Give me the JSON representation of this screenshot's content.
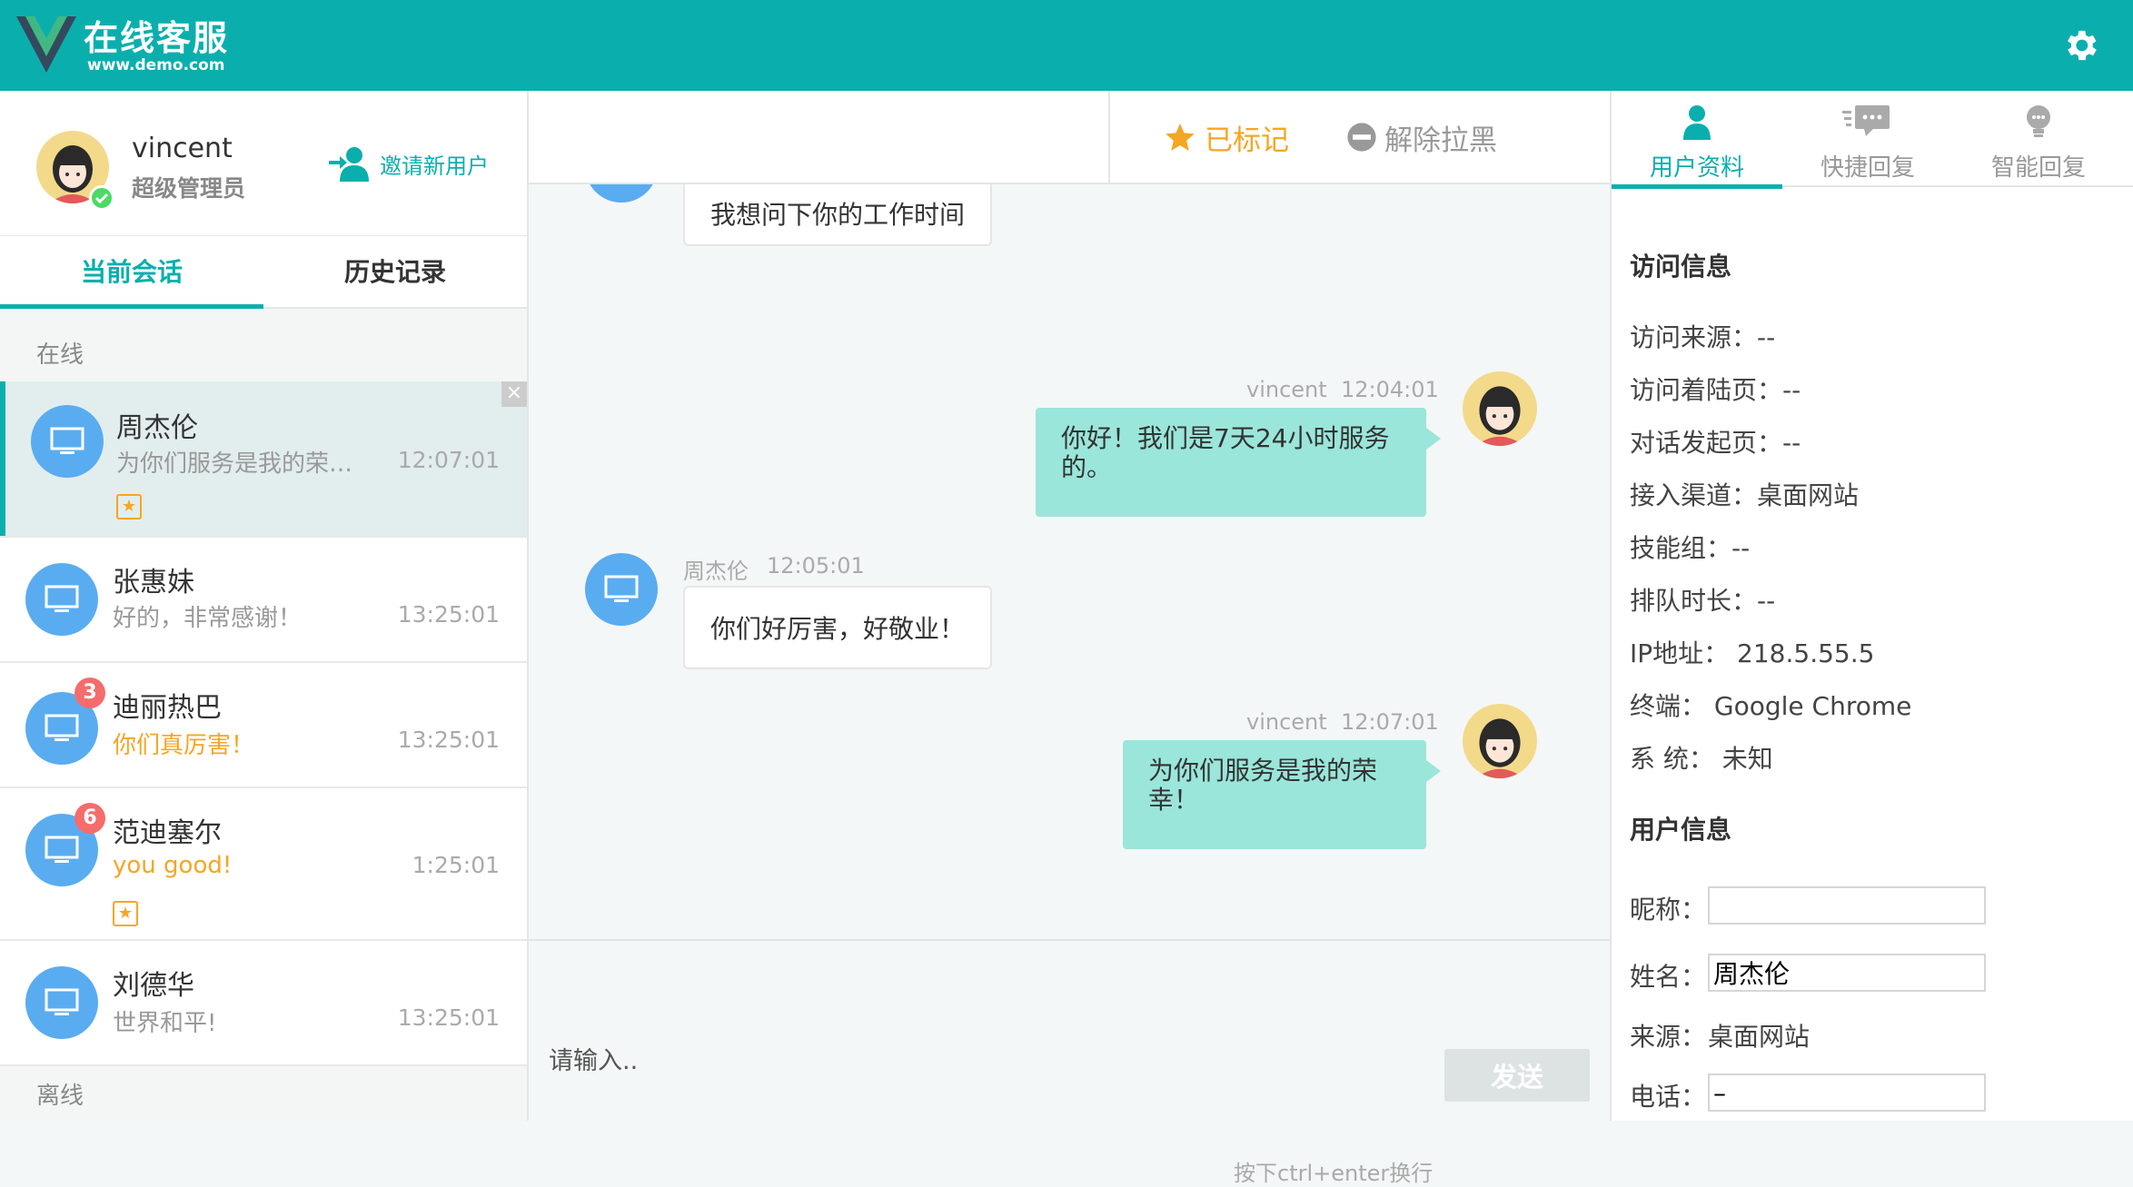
{
  "header": {
    "title": "在线客服",
    "subtitle": "www.demo.com",
    "brand_color": "#0aafad"
  },
  "admin": {
    "name": "vincent",
    "role": "超级管理员",
    "invite_label": "邀请新用户"
  },
  "left_tabs": {
    "current": "当前会话",
    "history": "历史记录"
  },
  "groups": {
    "online": "在线",
    "offline": "离线"
  },
  "sessions": [
    {
      "name": "周杰伦",
      "message": "为你们服务是我的荣…",
      "time": "12:07:01",
      "badge": "",
      "starred": true,
      "active": true,
      "unread": false
    },
    {
      "name": "张惠妹",
      "message": "好的，非常感谢！",
      "time": "13:25:01",
      "badge": "",
      "starred": false,
      "active": false,
      "unread": false
    },
    {
      "name": "迪丽热巴",
      "message": "你们真厉害！",
      "time": "13:25:01",
      "badge": "3",
      "starred": false,
      "active": false,
      "unread": true
    },
    {
      "name": "范迪塞尔",
      "message": "you good!",
      "time": "1:25:01",
      "badge": "6",
      "starred": true,
      "active": false,
      "unread": true
    },
    {
      "name": "刘德华",
      "message": "世界和平!",
      "time": "13:25:01",
      "badge": "",
      "starred": false,
      "active": false,
      "unread": false
    }
  ],
  "chat_toolbar": {
    "marked_label": "已标记",
    "unblock_label": "解除拉黑"
  },
  "messages": [
    {
      "from": "customer",
      "sender": "",
      "time": "",
      "text": "我想问下你的工作时间"
    },
    {
      "from": "agent",
      "sender": "vincent",
      "time": "12:04:01",
      "text": "你好！我们是7天24小时服务的。"
    },
    {
      "from": "customer",
      "sender": "周杰伦",
      "time": "12:05:01",
      "text": "你们好厉害，好敬业！"
    },
    {
      "from": "agent",
      "sender": "vincent",
      "time": "12:07:01",
      "text": "为你们服务是我的荣幸！"
    }
  ],
  "composer": {
    "placeholder": "请输入..",
    "hint": "按下ctrl+enter换行",
    "send_label": "发送"
  },
  "right_tabs": [
    "用户资料",
    "快捷回复",
    "智能回复"
  ],
  "visit_info": {
    "title": "访问信息",
    "rows": [
      "访问来源：--",
      "访问着陆页：--",
      "对话发起页：--",
      "接入渠道：桌面网站",
      "技能组：--",
      "排队时长：--",
      "IP地址： 218.5.55.5",
      "终端： Google Chrome",
      "系 统： 未知"
    ]
  },
  "user_info": {
    "title": "用户信息",
    "nickname_label": "昵称：",
    "nickname_value": "",
    "name_label": "姓名：",
    "name_value": "周杰伦",
    "source_label": "来源：",
    "source_value": "桌面网站",
    "phone_label": "电话：",
    "phone_value": "–"
  }
}
